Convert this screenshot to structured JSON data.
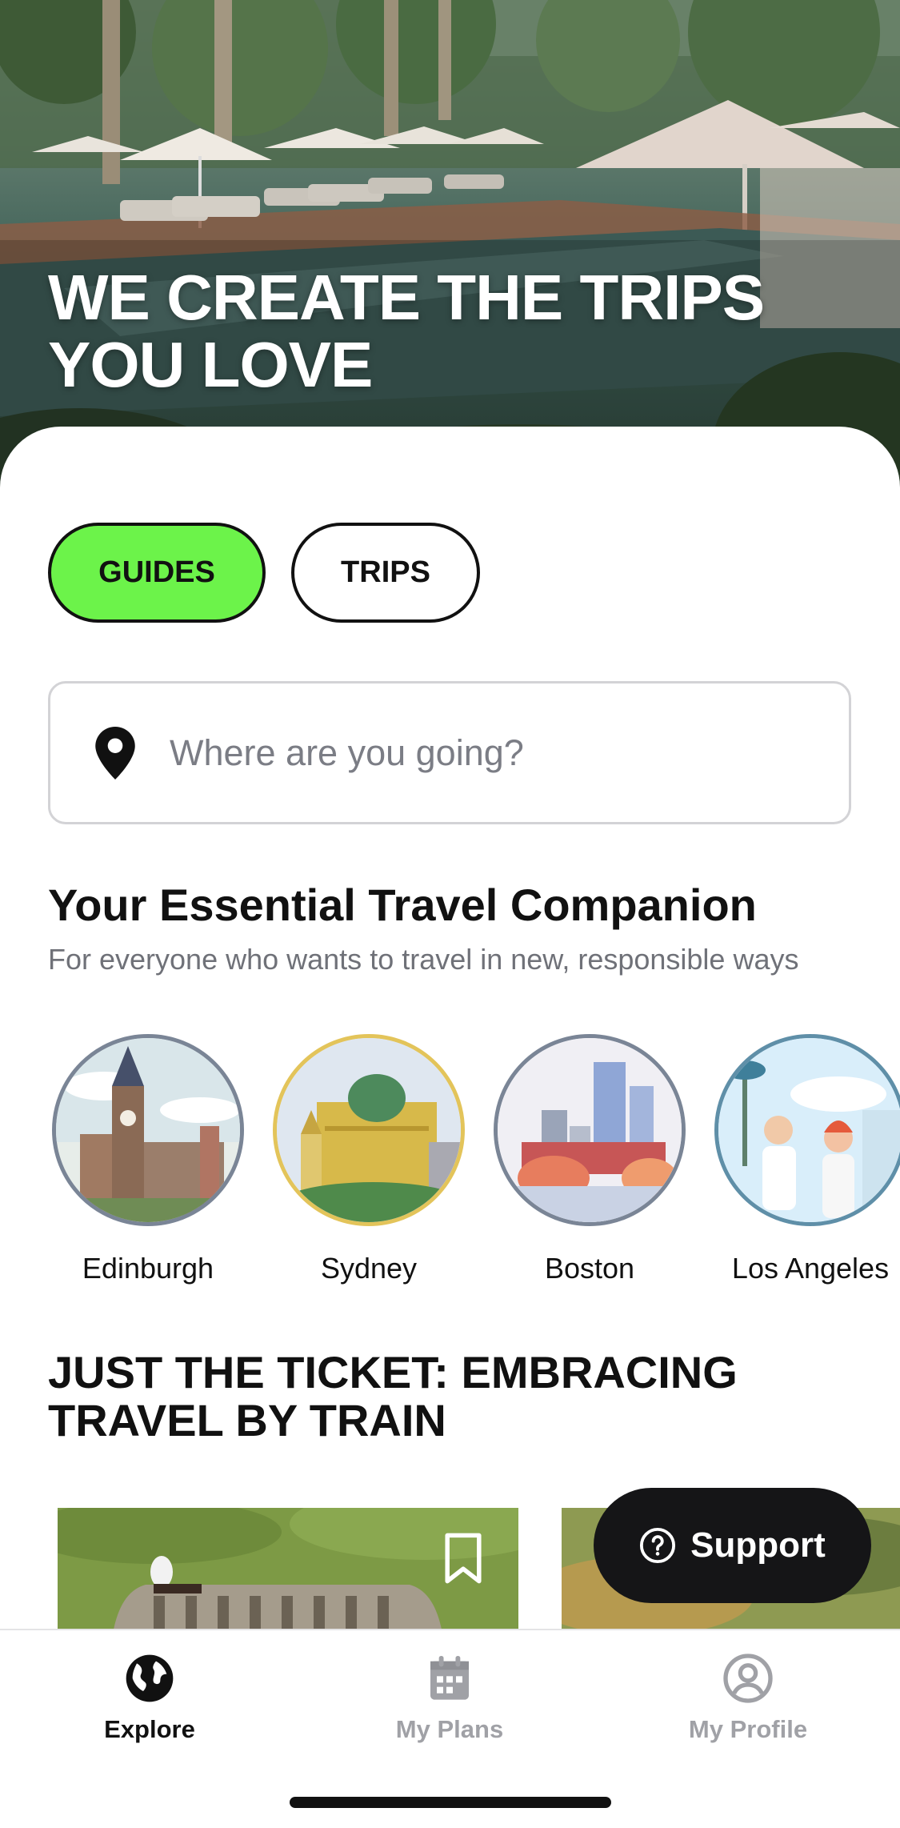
{
  "hero": {
    "title_line1": "WE CREATE THE TRIPS",
    "title_line2": "YOU LOVE"
  },
  "tabs": {
    "guides_label": "GUIDES",
    "trips_label": "TRIPS",
    "active": "GUIDES",
    "active_color": "#6cf34a"
  },
  "search": {
    "placeholder": "Where are you going?",
    "icon": "location-pin-icon"
  },
  "companion": {
    "title": "Your Essential Travel Companion",
    "subtitle": "For everyone who wants to travel in new, responsible ways"
  },
  "cities": [
    {
      "name": "Edinburgh"
    },
    {
      "name": "Sydney"
    },
    {
      "name": "Boston"
    },
    {
      "name": "Los Angeles"
    }
  ],
  "article": {
    "title_line1": "JUST THE TICKET: EMBRACING",
    "title_line2": "TRAVEL BY TRAIN",
    "bookmark_icon": "bookmark-icon"
  },
  "support": {
    "label": "Support",
    "icon": "question-circle-icon"
  },
  "tabbar": {
    "items": [
      {
        "label": "Explore",
        "icon": "globe-icon",
        "active": true
      },
      {
        "label": "My Plans",
        "icon": "calendar-icon",
        "active": false
      },
      {
        "label": "My Profile",
        "icon": "user-circle-icon",
        "active": false
      }
    ]
  }
}
